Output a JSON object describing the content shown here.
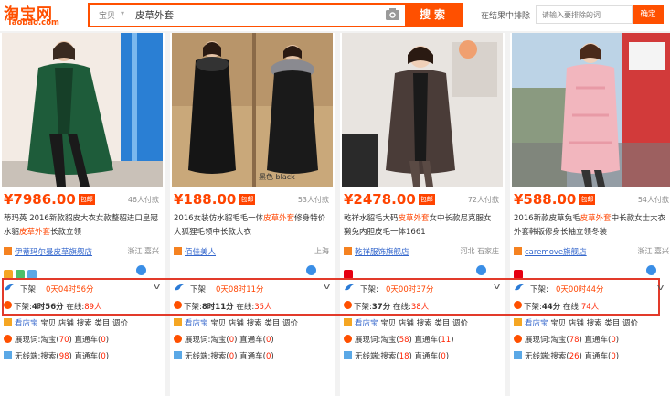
{
  "header": {
    "logo_text": "淘宝网",
    "logo_sub": "Taobao.com",
    "search_category": "宝贝",
    "search_value": "皮草外套",
    "search_button": "搜索",
    "filter_label": "在结果中排除",
    "filter_placeholder": "请输入要排除的词",
    "filter_button": "确定"
  },
  "colors": {
    "accent": "#ff5000",
    "price": "#ff4400",
    "highlight_border": "#e23a2a",
    "link": "#3366cc"
  },
  "products": [
    {
      "price": "¥7986.00",
      "badge": "包邮",
      "paid": "46人付款",
      "title_a": "蒂玛英 2016新款貂皮大衣女款整貂进口皇冠水貂",
      "title_hl": "皮草外套",
      "title_b": "长款立领",
      "shop": "伊蒂玛尔曼皮草旗舰店",
      "location": "浙江 嘉兴",
      "up_label": "下架:",
      "up_time": "0天04时56分",
      "down_label": "下架:",
      "down_time": "4时56分",
      "online_label": "在线",
      "online_count": "89人",
      "s1_label": "看店宝",
      "s1_text": "宝贝 店铺 搜索 类目 调价",
      "s2_label": "展现词:淘宝(",
      "s2_num": "70",
      "s2_mid": ") 直通车(",
      "s2_num2": "0",
      "s2_end": ")",
      "s3_label": "无线端:搜索(",
      "s3_num": "98",
      "s3_mid": ") 直通车(",
      "s3_num2": "0",
      "s3_end": ")"
    },
    {
      "price": "¥188.00",
      "badge": "包邮",
      "paid": "53人付款",
      "title_a": "2016女装仿水貂毛毛一体",
      "title_hl": "皮草外套",
      "title_b": "修身特价大狐狸毛领中长款大衣",
      "shop": "佰佳美人",
      "location": "上海",
      "up_label": "下架:",
      "up_time": "0天08时11分",
      "down_label": "下架:",
      "down_time": "8时11分",
      "online_label": "在线",
      "online_count": "35人",
      "s1_label": "看店宝",
      "s1_text": "宝贝 店铺 搜索 类目 调价",
      "s2_label": "展现词:淘宝(",
      "s2_num": "0",
      "s2_mid": ") 直通车(",
      "s2_num2": "0",
      "s2_end": ")",
      "s3_label": "无线端:搜索(",
      "s3_num": "0",
      "s3_mid": ") 直通车(",
      "s3_num2": "0",
      "s3_end": ")"
    },
    {
      "price": "¥2478.00",
      "badge": "包邮",
      "paid": "72人付款",
      "title_a": "乾祥水貂毛大码",
      "title_hl": "皮草外套",
      "title_b": "女中长款尼克服女獭兔内胆皮毛一体1661",
      "shop": "乾祥服饰旗舰店",
      "location": "河北 石家庄",
      "up_label": "下架:",
      "up_time": "0天00时37分",
      "down_label": "下架:",
      "down_time": "37分",
      "online_label": "在线",
      "online_count": "38人",
      "s1_label": "看店宝",
      "s1_text": "宝贝 店铺 搜索 类目 调价",
      "s2_label": "展现词:淘宝(",
      "s2_num": "58",
      "s2_mid": ") 直通车(",
      "s2_num2": "11",
      "s2_end": ")",
      "s3_label": "无线端:搜索(",
      "s3_num": "18",
      "s3_mid": ") 直通车(",
      "s3_num2": "0",
      "s3_end": ")"
    },
    {
      "price": "¥588.00",
      "badge": "包邮",
      "paid": "54人付款",
      "title_a": "2016新款皮草兔毛",
      "title_hl": "皮草外套",
      "title_b": "中长款女士大衣外套韩版修身长袖立领冬装",
      "shop": "caremove旗舰店",
      "location": "浙江 嘉兴",
      "up_label": "下架:",
      "up_time": "0天00时44分",
      "down_label": "下架:",
      "down_time": "44分",
      "online_label": "在线",
      "online_count": "74人",
      "s1_label": "看店宝",
      "s1_text": "宝贝 店铺 搜索 类目 调价",
      "s2_label": "展现词:淘宝(",
      "s2_num": "78",
      "s2_mid": ") 直通车(",
      "s2_num2": "0",
      "s2_end": ")",
      "s3_label": "无线端:搜索(",
      "s3_num": "26",
      "s3_mid": ") 直通车(",
      "s3_num2": "0",
      "s3_end": ")"
    }
  ]
}
